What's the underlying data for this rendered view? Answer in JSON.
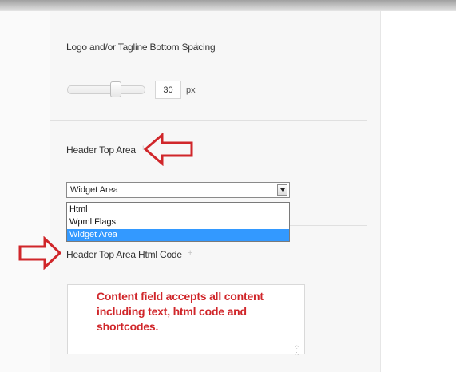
{
  "fields": {
    "logo_spacing": {
      "label": "Logo and/or Tagline Bottom Spacing",
      "help": "+",
      "slider_value": 30,
      "value": "30",
      "unit": "px"
    },
    "header_top_area": {
      "label": "Header Top Area",
      "help": "+",
      "selected": "Widget Area",
      "options": [
        "Html",
        "Wpml Flags",
        "Widget Area"
      ]
    },
    "header_top_area_html": {
      "label": "Header Top Area Html Code",
      "help": "+",
      "content": ""
    }
  },
  "annotation": {
    "note_text": "Content field accepts all content including text, html code and shortcodes.",
    "arrow_color": "#d0262a"
  },
  "colors": {
    "selected_option": "#3399ff",
    "panel_background": "#f7f7f7"
  }
}
